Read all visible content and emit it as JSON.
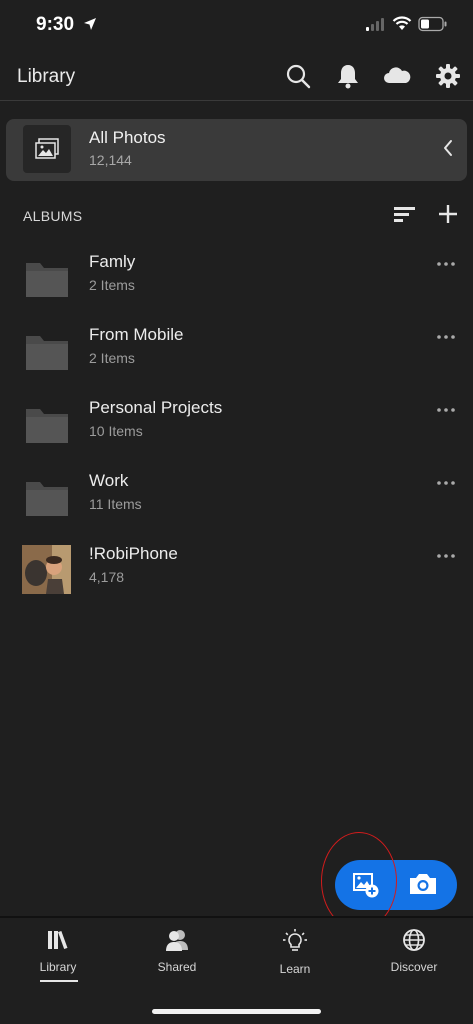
{
  "status": {
    "time": "9:30"
  },
  "header": {
    "title": "Library"
  },
  "all_photos": {
    "title": "All Photos",
    "count": "12,144"
  },
  "albums": {
    "heading": "ALBUMS",
    "items": [
      {
        "name": "Famly",
        "count": "2 Items"
      },
      {
        "name": "From Mobile",
        "count": "2 Items"
      },
      {
        "name": "Personal Projects",
        "count": "10 Items"
      },
      {
        "name": "Work",
        "count": "11 Items"
      },
      {
        "name": "!RobiPhone",
        "count": "4,178"
      }
    ]
  },
  "tabs": [
    {
      "label": "Library",
      "icon": "library-icon",
      "active": true
    },
    {
      "label": "Shared",
      "icon": "shared-icon"
    },
    {
      "label": "Learn",
      "icon": "learn-icon"
    },
    {
      "label": "Discover",
      "icon": "discover-icon"
    }
  ],
  "colors": {
    "background": "#1f1f1f",
    "accent": "#1473e6",
    "annotation": "#d21c1c"
  }
}
